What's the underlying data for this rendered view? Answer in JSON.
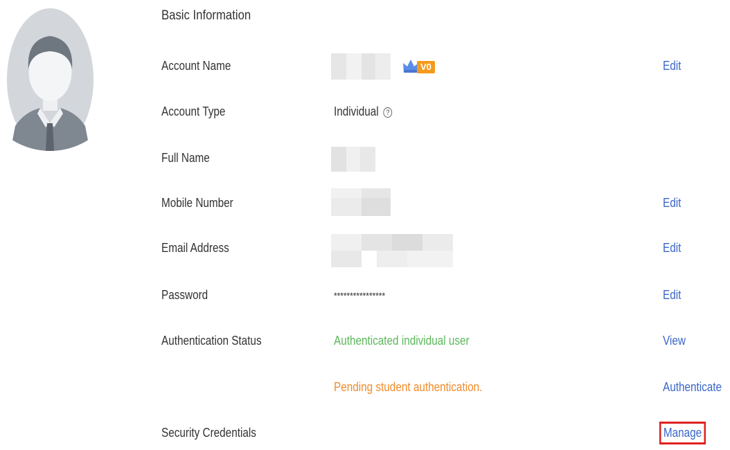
{
  "section_title": "Basic Information",
  "rows": {
    "account_name": {
      "label": "Account Name",
      "level_badge": "V0",
      "action": "Edit"
    },
    "account_type": {
      "label": "Account Type",
      "value": "Individual",
      "help_icon": "question-circle-icon"
    },
    "full_name": {
      "label": "Full Name"
    },
    "mobile_number": {
      "label": "Mobile Number",
      "action": "Edit"
    },
    "email_address": {
      "label": "Email Address",
      "action": "Edit"
    },
    "password": {
      "label": "Password",
      "value": "****************",
      "action": "Edit"
    },
    "authentication_status": {
      "label": "Authentication Status",
      "value": "Authenticated individual user",
      "action": "View"
    },
    "student_authentication": {
      "value": "Pending student authentication.",
      "action": "Authenticate"
    },
    "security_credentials": {
      "label": "Security Credentials",
      "action": "Manage"
    }
  },
  "colors": {
    "link": "#3a66c9",
    "authenticated": "#5cb85c",
    "pending": "#f08c2c",
    "highlight_box": "#e02020",
    "badge": "#f59a1d"
  }
}
